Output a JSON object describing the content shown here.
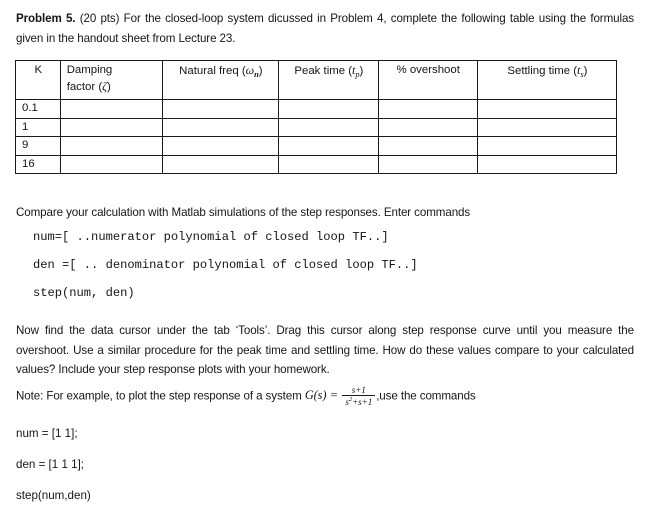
{
  "document": {
    "intro": {
      "label_bold": "Problem 5.",
      "text": " (20 pts) For the closed-loop system dicussed in Problem 4, complete the following table using the formulas given in the handout sheet from Lecture 23."
    },
    "table": {
      "headers": [
        "K",
        "Damping factor (ζ)",
        "Natural freq (ωn)",
        "Peak time (tp)",
        "% overshoot",
        "Settling time (ts)"
      ],
      "header_parts": {
        "k": "K",
        "damping_line1": "Damping",
        "damping_line2": "factor (",
        "damping_symbol": "ζ",
        "damping_close": ")",
        "natural_text": "Natural freq (",
        "natural_symbol": "ω",
        "natural_sub": "n",
        "natural_close": ")",
        "peak_text": "Peak time (",
        "peak_symbol": "t",
        "peak_sub": "p",
        "peak_close": ")",
        "overshoot": "% overshoot",
        "settling_text": "Settling time (",
        "settling_symbol": "t",
        "settling_sub": "s",
        "settling_close": ")"
      },
      "rows": [
        {
          "k": "0.1",
          "damping": "",
          "natural_freq": "",
          "peak_time": "",
          "overshoot": "",
          "settling_time": ""
        },
        {
          "k": "1",
          "damping": "",
          "natural_freq": "",
          "peak_time": "",
          "overshoot": "",
          "settling_time": ""
        },
        {
          "k": "9",
          "damping": "",
          "natural_freq": "",
          "peak_time": "",
          "overshoot": "",
          "settling_time": ""
        },
        {
          "k": "16",
          "damping": "",
          "natural_freq": "",
          "peak_time": "",
          "overshoot": "",
          "settling_time": ""
        }
      ]
    },
    "compare_paragraph": "Compare your calculation with Matlab simulations of the step responses. Enter commands",
    "code_block": [
      "num=[ ..numerator polynomial of closed loop TF..]",
      "den =[ .. denominator polynomial of closed loop TF..]",
      "step(num, den)"
    ],
    "cursor_paragraph": "Now find the data cursor under the tab ‘Tools’. Drag this cursor along step response curve until you measure the overshoot. Use a similar procedure for the peak time and settling time. How do these values compare to your calculated values? Include your step response plots with your homework.",
    "note": {
      "prefix": "Note: For example, to plot the step response of a system ",
      "g_of_s": "G(s)",
      "equals": "=",
      "numerator": "s+1",
      "denominator_base": "s",
      "denominator_exp": "2",
      "denominator_rest": "+s+1",
      "suffix": ",use the commands"
    },
    "commands": [
      "num = [1 1];",
      "den = [1 1 1];",
      "step(num,den)"
    ]
  }
}
